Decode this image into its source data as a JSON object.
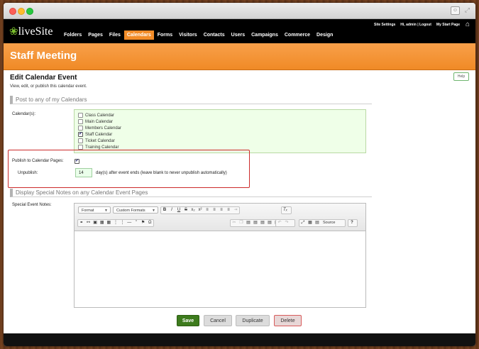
{
  "titlebar": {
    "user_icon": "person-icon",
    "expand_icon": "expand-arrows-icon"
  },
  "topnav": {
    "logo_text": "liveSite",
    "menu": [
      {
        "label": "Folders",
        "active": false
      },
      {
        "label": "Pages",
        "active": false
      },
      {
        "label": "Files",
        "active": false
      },
      {
        "label": "Calendars",
        "active": true
      },
      {
        "label": "Forms",
        "active": false
      },
      {
        "label": "Visitors",
        "active": false
      },
      {
        "label": "Contacts",
        "active": false
      },
      {
        "label": "Users",
        "active": false
      },
      {
        "label": "Campaigns",
        "active": false
      },
      {
        "label": "Commerce",
        "active": false
      },
      {
        "label": "Design",
        "active": false
      }
    ],
    "site_settings": "Site Settings",
    "greeting": "Hi, admin | Logout",
    "start_page": "My Start Page",
    "accent_color": "#f28c28"
  },
  "banner": {
    "title": "Staff Meeting",
    "color": "#f28c28"
  },
  "page": {
    "title": "Edit Calendar Event",
    "subtitle": "View, edit, or publish this calendar event.",
    "help_label": "Help"
  },
  "post_section": {
    "heading": "Post to any of my Calendars",
    "calendars_label": "Calendar(s):",
    "calendars": [
      {
        "name": "Class Calendar",
        "checked": false
      },
      {
        "name": "Main Calendar",
        "checked": false
      },
      {
        "name": "Members Calendar",
        "checked": false
      },
      {
        "name": "Staff Calendar",
        "checked": true
      },
      {
        "name": "Ticket Calendar",
        "checked": false
      },
      {
        "name": "Training Calendar",
        "checked": false
      }
    ],
    "publish_label": "Publish to Calendar Pages:",
    "publish_checked": true,
    "unpublish_label": "Unpublish:",
    "unpublish_value": "14",
    "unpublish_hint": "day(s) after event ends (leave blank to never unpublish automatically)"
  },
  "notes_section": {
    "heading": "Display Special Notes on any Calendar Event Pages",
    "notes_label": "Special Event Notes:",
    "format_label": "Format",
    "custom_formats_label": "Custom Formats",
    "source_label": "Source"
  },
  "actions": {
    "save": "Save",
    "cancel": "Cancel",
    "duplicate": "Duplicate",
    "delete": "Delete"
  }
}
